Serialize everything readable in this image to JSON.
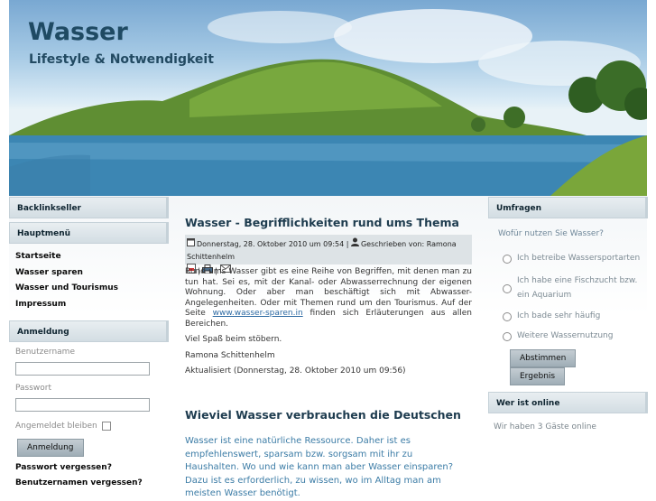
{
  "header": {
    "site_title": "Wasser",
    "site_slogan": "Lifestyle & Notwendigkeit"
  },
  "left": {
    "backlink_title": "Backlinkseller",
    "menu_title": "Hauptmenü",
    "menu_items": [
      "Startseite",
      "Wasser sparen",
      "Wasser und Tourismus",
      "Impressum"
    ],
    "login": {
      "title": "Anmeldung",
      "username_label": "Benutzername",
      "password_label": "Passwort",
      "remember_label": "Angemeldet bleiben",
      "submit_label": "Anmeldung",
      "forgot_password": "Passwort vergessen?",
      "forgot_username": "Benutzernamen vergessen?"
    }
  },
  "main": {
    "article1": {
      "title": "Wasser - Begrifflichkeiten rund ums Thema",
      "date": "Donnerstag, 28. Oktober 2010 um 09:54",
      "author": "Geschrieben von: Ramona Schittenhelm",
      "body_text": "Rund ums Wasser gibt es eine Reihe von Begriffen, mit denen man zu tun hat. Sei es, mit der Kanal- oder Abwasserrechnung der eigenen Wohnung. Oder aber man beschäftigt sich mit Abwasser-Angelegenheiten. Oder mit Themen rund um den Tourismus. Auf der Seite ",
      "link_text": "www.wasser-sparen.in",
      "body_text_after": " finden sich Erläuterungen aus allen Bereichen.",
      "line2": "Viel Spaß beim stöbern.",
      "signature": "Ramona Schittenhelm",
      "updated": "Aktualisiert (Donnerstag, 28. Oktober 2010 um 09:56)"
    },
    "article2": {
      "title": "Wieviel Wasser verbrauchen die Deutschen",
      "intro": "Wasser ist eine natürliche Ressource. Daher ist es empfehlenswert, sparsam bzw. sorgsam mit ihr zu Haushalten. Wo und wie kann man aber Wasser einsparen? Dazu ist es erforderlich, zu wissen, wo im Alltag man am meisten Wasser benötigt."
    }
  },
  "right": {
    "poll_title": "Umfragen",
    "poll_question": "Wofür nutzen Sie Wasser?",
    "poll_options": [
      "Ich betreibe Wassersportarten",
      "Ich habe eine Fischzucht bzw. ein Aquarium",
      "Ich bade sehr häufig",
      "Weitere Wassernutzung"
    ],
    "vote_label": "Abstimmen",
    "results_label": "Ergebnis",
    "online_title": "Wer ist online",
    "online_text": "Wir haben 3 Gäste online"
  },
  "icons": [
    "calendar-icon",
    "user-icon",
    "pdf-icon",
    "print-icon",
    "email-icon"
  ]
}
